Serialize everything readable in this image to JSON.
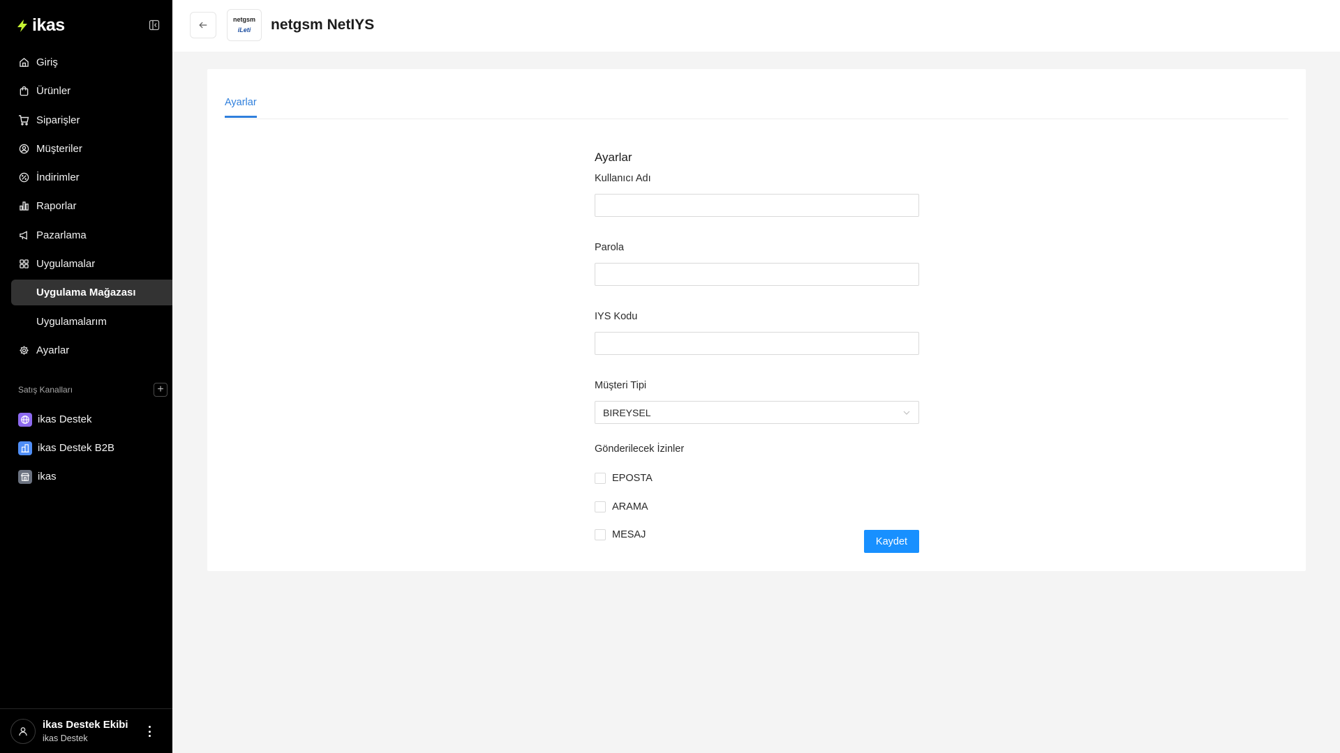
{
  "brand": {
    "name": "ikas",
    "accent": "#c6f432"
  },
  "sidebar": {
    "items": [
      {
        "label": "Giriş",
        "icon": "home-icon"
      },
      {
        "label": "Ürünler",
        "icon": "bag-icon"
      },
      {
        "label": "Siparişler",
        "icon": "cart-icon"
      },
      {
        "label": "Müşteriler",
        "icon": "user-circle-icon"
      },
      {
        "label": "İndirimler",
        "icon": "discount-icon"
      },
      {
        "label": "Raporlar",
        "icon": "bar-chart-icon"
      },
      {
        "label": "Pazarlama",
        "icon": "megaphone-icon"
      },
      {
        "label": "Uygulamalar",
        "icon": "apps-grid-icon"
      },
      {
        "label": "Uygulama Mağazası",
        "sub": true,
        "active": true
      },
      {
        "label": "Uygulamalarım",
        "sub": true
      },
      {
        "label": "Ayarlar",
        "icon": "gear-icon"
      }
    ],
    "channels_title": "Satış Kanalları",
    "channels": [
      {
        "label": "ikas Destek",
        "icon": "globe-icon",
        "color": "#8d6af0"
      },
      {
        "label": "ikas Destek B2B",
        "icon": "building-icon",
        "color": "#4f8ef7"
      },
      {
        "label": "ikas",
        "icon": "store-icon",
        "color": "#6b7280"
      }
    ],
    "user": {
      "name": "ikas Destek Ekibi",
      "store": "ikas Destek"
    }
  },
  "header": {
    "title": "netgsm NetIYS",
    "logo": {
      "brand": "netgsm",
      "tag": "iLeti"
    }
  },
  "tabs": [
    {
      "label": "Ayarlar",
      "active": true
    }
  ],
  "form": {
    "title": "Ayarlar",
    "username": {
      "label": "Kullanıcı Adı",
      "value": ""
    },
    "password": {
      "label": "Parola",
      "value": ""
    },
    "iys_code": {
      "label": "IYS Kodu",
      "value": ""
    },
    "customer_type": {
      "label": "Müşteri Tipi",
      "value": "BIREYSEL"
    },
    "permissions": {
      "label": "Gönderilecek İzinler",
      "options": [
        {
          "label": "EPOSTA",
          "checked": false
        },
        {
          "label": "ARAMA",
          "checked": false
        },
        {
          "label": "MESAJ",
          "checked": false
        }
      ]
    },
    "save_label": "Kaydet"
  },
  "colors": {
    "primary": "#1890ff",
    "tab_active": "#2f7fdc",
    "sidebar_bg": "#000000"
  }
}
